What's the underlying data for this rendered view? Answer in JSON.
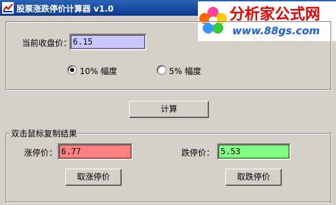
{
  "window": {
    "title": "股票涨跌停价计算器 v1.0",
    "icon": "app-icon"
  },
  "watermark": {
    "brand": "分析家公式网",
    "url": "www.88gs.com"
  },
  "price_section": {
    "label": "当前收盘价：",
    "value": "6.15",
    "field_bg": "#c8c8ff"
  },
  "limit_options": {
    "option_10": "10% 幅度",
    "option_5": "5% 幅度",
    "selected": "10% 幅度"
  },
  "calc_button": "计算",
  "results": {
    "legend": "双击鼠标复制结果",
    "up_label": "涨停价：",
    "up_value": "6.77",
    "up_bg": "#ff8080",
    "down_label": "跌停价：",
    "down_value": "5.53",
    "down_bg": "#80ff80",
    "up_cancel": "取涨停价",
    "down_cancel": "取跌停价"
  },
  "colors": {
    "title_bar": "#0a3a8e",
    "window_bg": "#d4d0c8",
    "watermark_text": "#e60000"
  }
}
